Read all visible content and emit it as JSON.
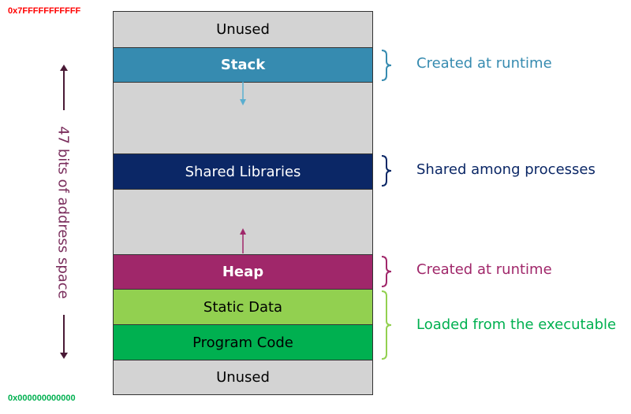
{
  "addresses": {
    "top": "0x7FFFFFFFFFFF",
    "bottom": "0x000000000000",
    "top_color": "#ff0000",
    "bottom_color": "#00b050"
  },
  "axis_label": "47 bits of address space",
  "segments": {
    "unused_top": "Unused",
    "stack": "Stack",
    "shared": "Shared Libraries",
    "heap": "Heap",
    "static": "Static Data",
    "program": "Program Code",
    "unused_bottom": "Unused"
  },
  "notes": {
    "stack": "Created at runtime",
    "shared": "Shared among processes",
    "heap": "Created at runtime",
    "loaded": "Loaded from the executable"
  },
  "colors": {
    "stack": "#368bb0",
    "shared": "#0b2766",
    "heap": "#a0276a",
    "static": "#92d050",
    "program": "#00b050",
    "unused": "#d3d3d3"
  }
}
